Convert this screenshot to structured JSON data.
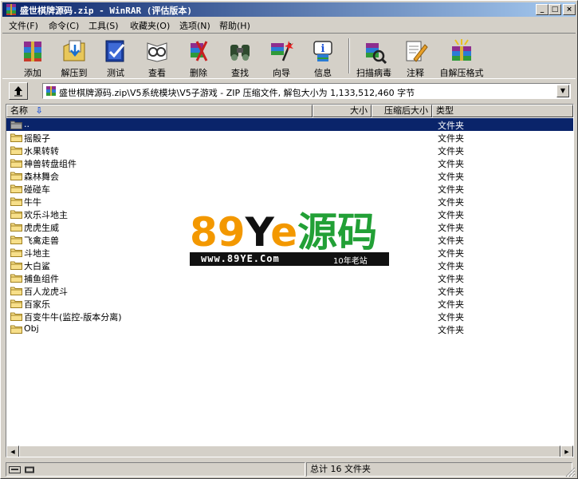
{
  "window": {
    "title": "盛世棋牌源码.zip - WinRAR (评估版本)",
    "minimize_glyph": "_",
    "maximize_glyph": "□",
    "close_glyph": "×"
  },
  "menu": [
    {
      "label": "文件(F)"
    },
    {
      "label": "命令(C)"
    },
    {
      "label": "工具(S)"
    },
    {
      "label": "收藏夹(O)"
    },
    {
      "label": "选项(N)"
    },
    {
      "label": "帮助(H)"
    }
  ],
  "toolbar": [
    {
      "label": "添加",
      "icon": "add-archive-icon"
    },
    {
      "label": "解压到",
      "icon": "extract-to-icon"
    },
    {
      "label": "测试",
      "icon": "test-icon"
    },
    {
      "label": "查看",
      "icon": "view-icon"
    },
    {
      "label": "删除",
      "icon": "delete-icon"
    },
    {
      "label": "查找",
      "icon": "find-icon"
    },
    {
      "label": "向导",
      "icon": "wizard-icon"
    },
    {
      "label": "信息",
      "icon": "info-icon"
    },
    {
      "label": "扫描病毒",
      "icon": "virus-scan-icon"
    },
    {
      "label": "注释",
      "icon": "comment-icon"
    },
    {
      "label": "自解压格式",
      "icon": "sfx-icon"
    }
  ],
  "address": {
    "path": "盛世棋牌源码.zip\\V5系统模块\\V5子游戏 - ZIP 压缩文件, 解包大小为 1,133,512,460 字节"
  },
  "columns": {
    "name": "名称",
    "size": "大小",
    "packed": "压缩后大小",
    "type": "类型"
  },
  "files": [
    {
      "name": "..",
      "type": "文件夹",
      "selected": true,
      "icon": "parent-folder-icon"
    },
    {
      "name": "摇骰子",
      "type": "文件夹"
    },
    {
      "name": "水果转转",
      "type": "文件夹"
    },
    {
      "name": "神兽转盘组件",
      "type": "文件夹"
    },
    {
      "name": "森林舞会",
      "type": "文件夹"
    },
    {
      "name": "碰碰车",
      "type": "文件夹"
    },
    {
      "name": "牛牛",
      "type": "文件夹"
    },
    {
      "name": "欢乐斗地主",
      "type": "文件夹"
    },
    {
      "name": "虎虎生威",
      "type": "文件夹"
    },
    {
      "name": "飞禽走兽",
      "type": "文件夹"
    },
    {
      "name": "斗地主",
      "type": "文件夹"
    },
    {
      "name": "大白鲨",
      "type": "文件夹"
    },
    {
      "name": "捕鱼组件",
      "type": "文件夹"
    },
    {
      "name": "百人龙虎斗",
      "type": "文件夹"
    },
    {
      "name": "百家乐",
      "type": "文件夹"
    },
    {
      "name": "百变牛牛(监控-版本分离)",
      "type": "文件夹"
    },
    {
      "name": "Obj",
      "type": "文件夹"
    }
  ],
  "watermark": {
    "brand_num": "89",
    "brand_y": "Y",
    "brand_e": "e",
    "brand_cn": "源码",
    "url": "www.89YE.Com",
    "tagline": "10年老站"
  },
  "status": {
    "summary": "总计 16 文件夹"
  },
  "colors": {
    "selection": "#0a246a",
    "title_gradient_start": "#0a246a",
    "title_gradient_end": "#a6caf0",
    "watermark_orange": "#f39800",
    "watermark_green": "#22a036"
  }
}
